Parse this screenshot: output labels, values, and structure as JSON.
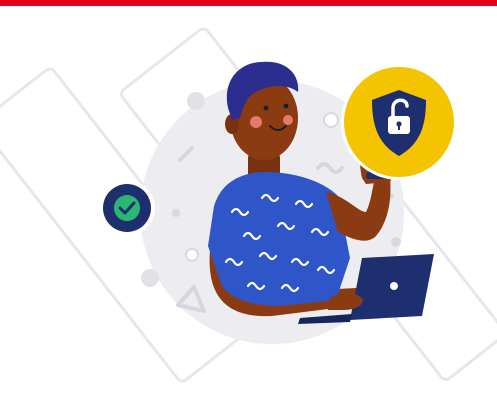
{
  "illustration": {
    "icons": [
      "check-badge-icon",
      "unlocked-shield-icon",
      "laptop-icon"
    ],
    "colors": {
      "top_bar": "#e4001b",
      "background_circle": "#ededf1",
      "skin": "#8a3b12",
      "hair": "#2b2e8e",
      "shirt": "#2f56c9",
      "shirt_pattern": "#ffffff",
      "cheek": "#e47a6a",
      "shield_circle": "#f5c400",
      "shield": "#1d2f6f",
      "check_circle": "#1d2f6f",
      "check_mark": "#2bb673",
      "laptop": "#1d2f6f"
    }
  }
}
